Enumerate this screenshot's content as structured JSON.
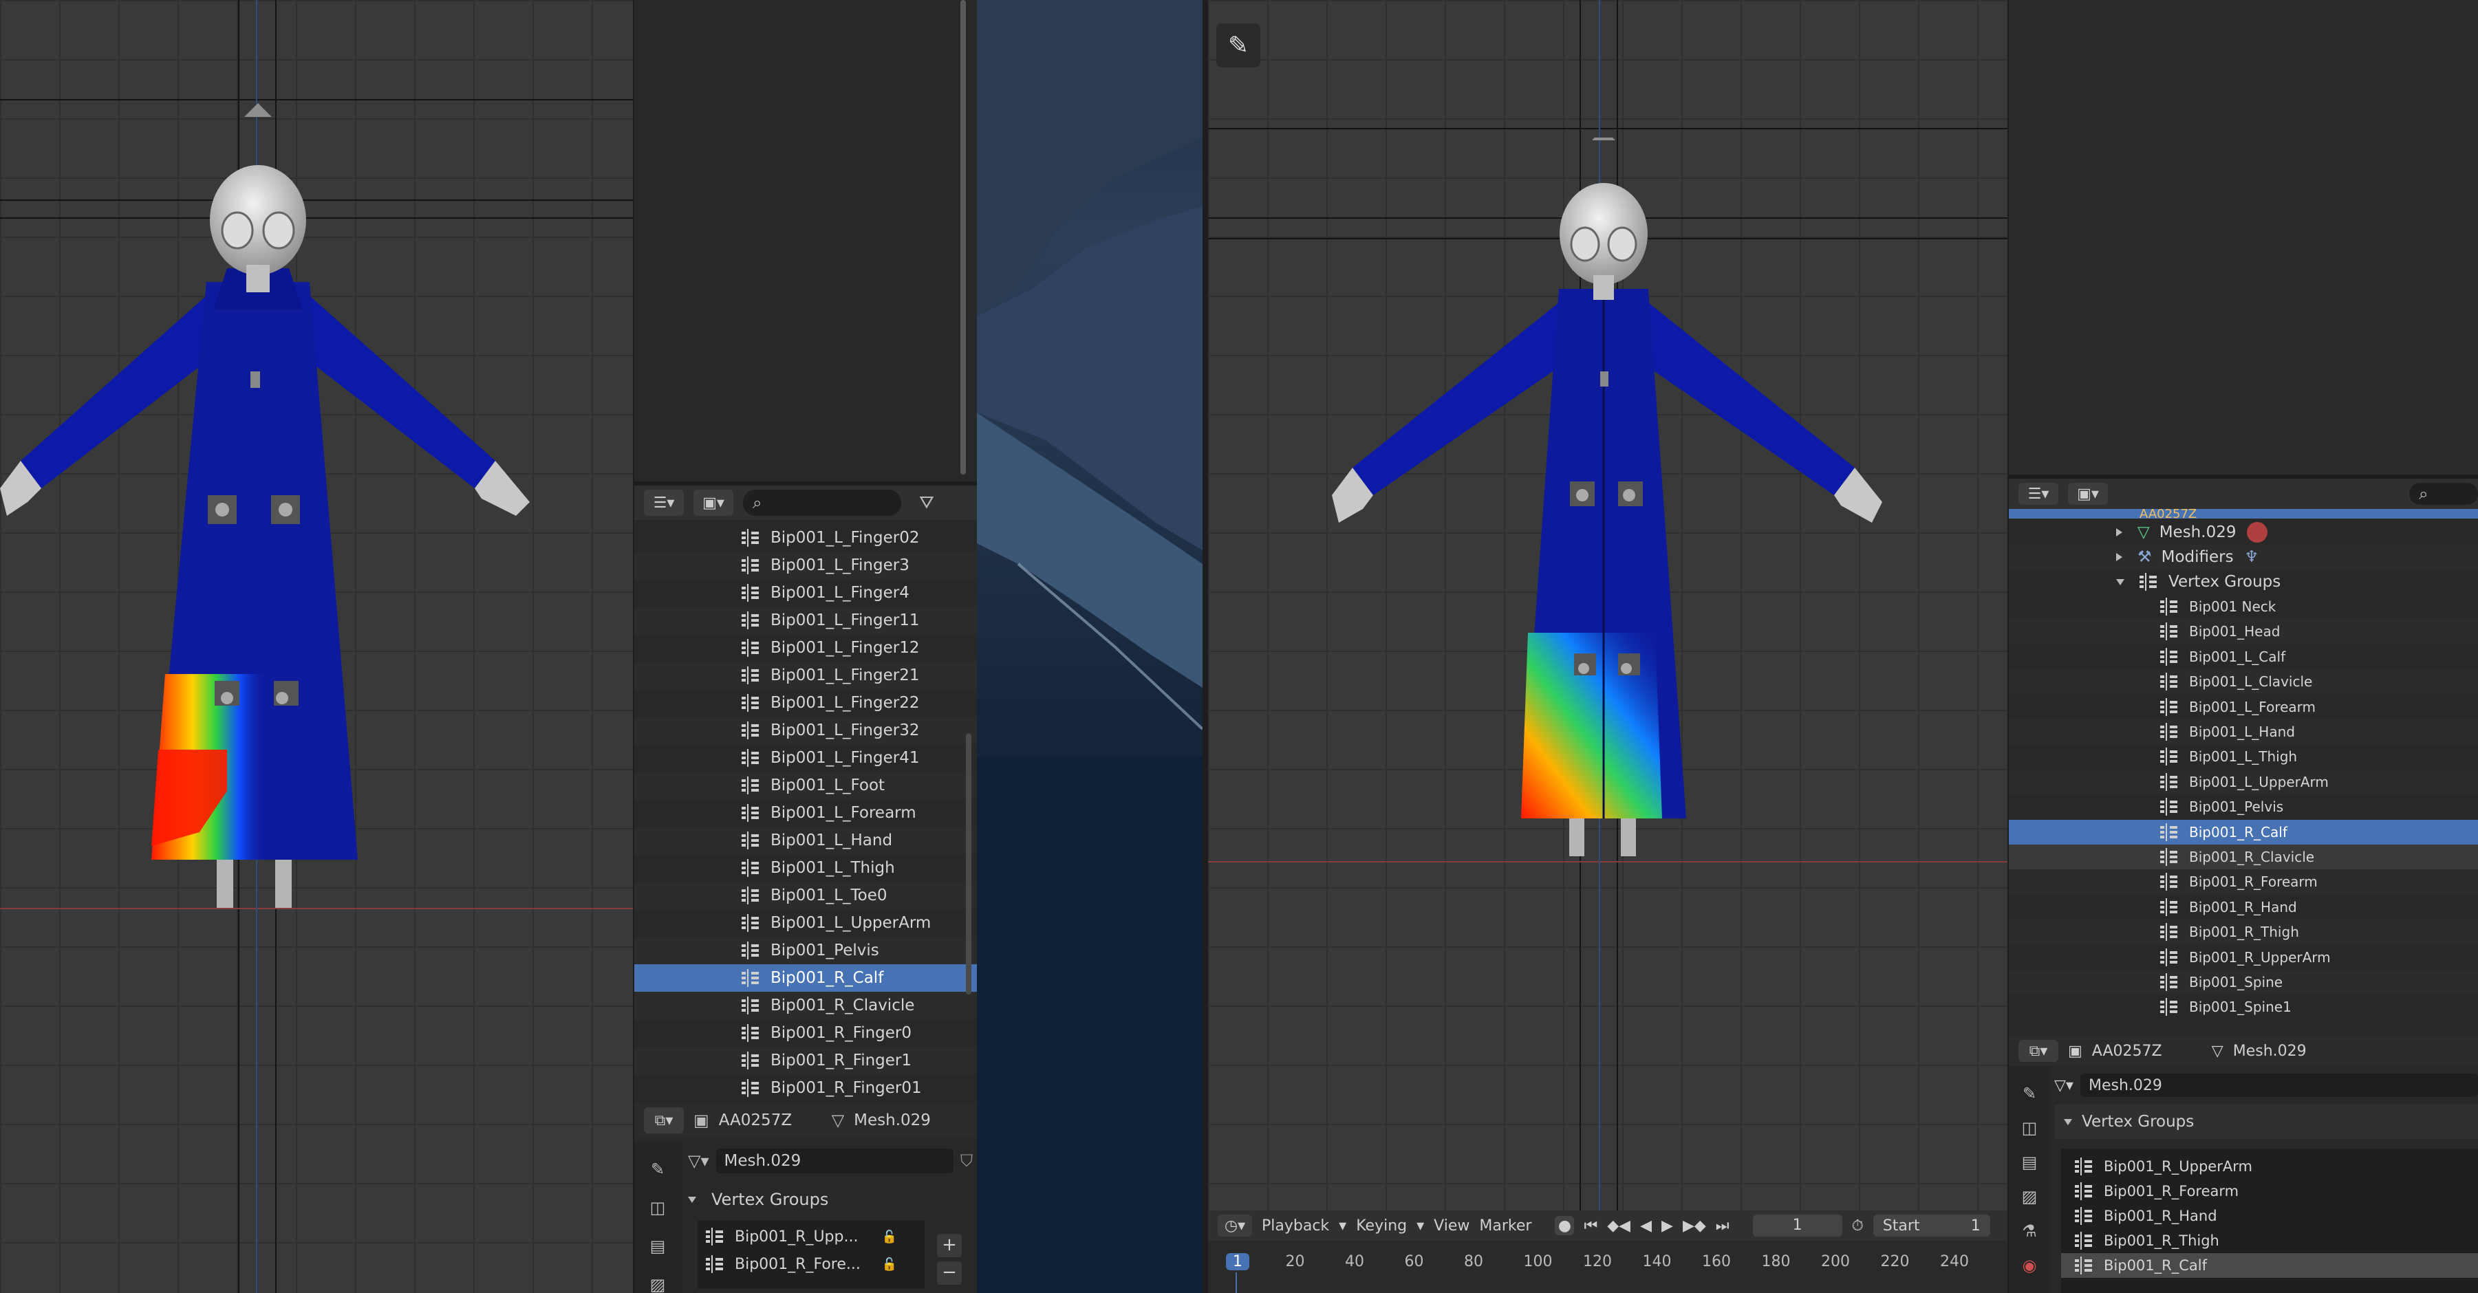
{
  "left_outliner": {
    "search_placeholder": "",
    "items": [
      "Bip001_L_Finger02",
      "Bip001_L_Finger3",
      "Bip001_L_Finger4",
      "Bip001_L_Finger11",
      "Bip001_L_Finger12",
      "Bip001_L_Finger21",
      "Bip001_L_Finger22",
      "Bip001_L_Finger32",
      "Bip001_L_Finger41",
      "Bip001_L_Foot",
      "Bip001_L_Forearm",
      "Bip001_L_Hand",
      "Bip001_L_Thigh",
      "Bip001_L_Toe0",
      "Bip001_L_UpperArm",
      "Bip001_Pelvis",
      "Bip001_R_Calf",
      "Bip001_R_Clavicle",
      "Bip001_R_Finger0",
      "Bip001_R_Finger1",
      "Bip001_R_Finger01"
    ],
    "selected_index": 16
  },
  "left_properties": {
    "object_name": "AA0257Z",
    "mesh_name": "Mesh.029",
    "mesh_field": "Mesh.029",
    "section": "Vertex Groups",
    "groups": [
      "Bip001_R_Upp...",
      "Bip001_R_Fore..."
    ]
  },
  "right_outliner": {
    "top_item": "AA0257Z",
    "mesh": "Mesh.029",
    "modifiers": "Modifiers",
    "vertex_groups_label": "Vertex Groups",
    "items": [
      "Bip001 Neck",
      "Bip001_Head",
      "Bip001_L_Calf",
      "Bip001_L_Clavicle",
      "Bip001_L_Forearm",
      "Bip001_L_Hand",
      "Bip001_L_Thigh",
      "Bip001_L_UpperArm",
      "Bip001_Pelvis",
      "Bip001_R_Calf",
      "Bip001_R_Clavicle",
      "Bip001_R_Forearm",
      "Bip001_R_Hand",
      "Bip001_R_Thigh",
      "Bip001_R_UpperArm",
      "Bip001_Spine",
      "Bip001_Spine1"
    ],
    "selected_index": 9,
    "hover_index": 10
  },
  "right_properties": {
    "object_name": "AA0257Z",
    "mesh_name": "Mesh.029",
    "mesh_field": "Mesh.029",
    "section": "Vertex Groups",
    "groups": [
      "Bip001_R_UpperArm",
      "Bip001_R_Forearm",
      "Bip001_R_Hand",
      "Bip001_R_Thigh",
      "Bip001_R_Calf"
    ],
    "selected_index": 4
  },
  "timeline": {
    "menus": [
      "Playback",
      "Keying",
      "View",
      "Marker"
    ],
    "current_frame": "1",
    "start_label": "Start",
    "start_value": "1",
    "ticks": [
      "1",
      "20",
      "40",
      "60",
      "80",
      "100",
      "120",
      "140",
      "160",
      "180",
      "200",
      "220",
      "240"
    ]
  },
  "colors": {
    "selection": "#4772b3",
    "robe": "#0d1a9c",
    "viewport": "#393939"
  }
}
